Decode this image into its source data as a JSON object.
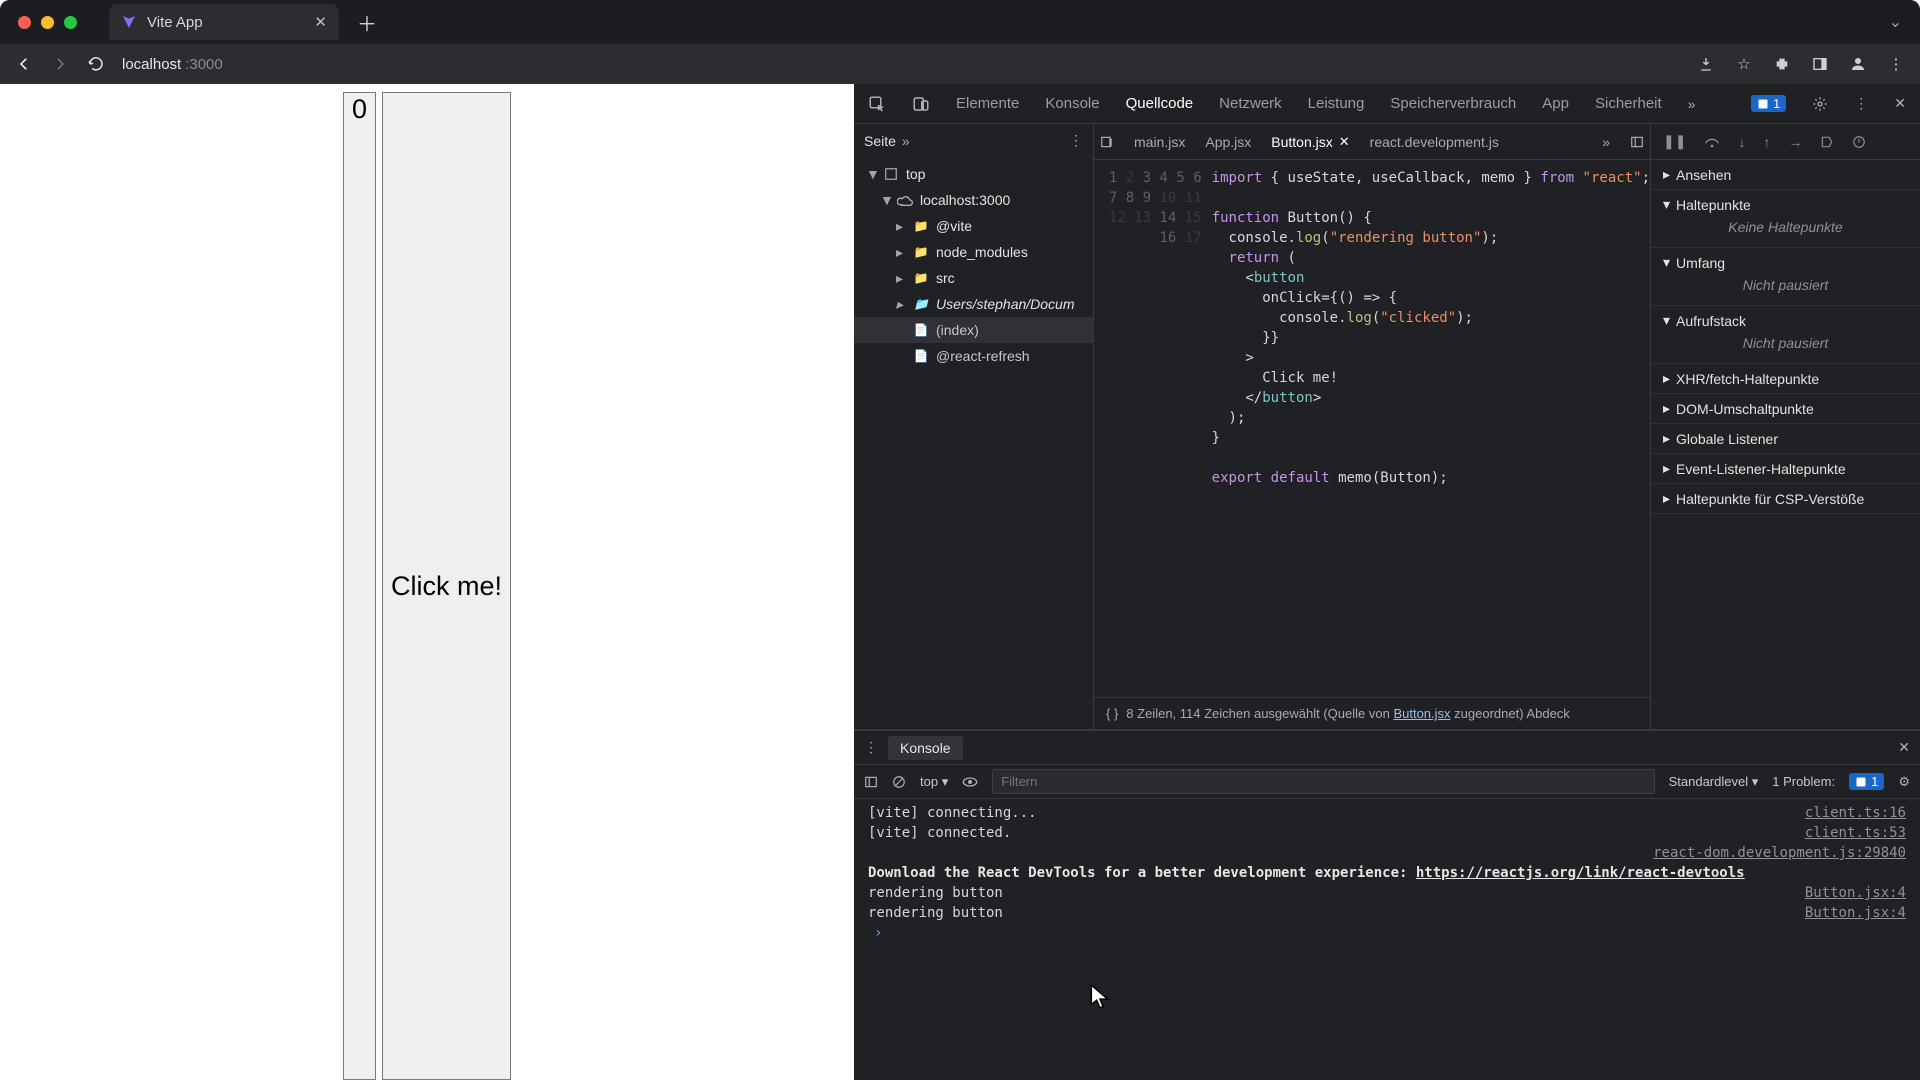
{
  "browser": {
    "tab_title": "Vite App",
    "address_host": "localhost",
    "address_port": ":3000"
  },
  "page": {
    "counter": "0",
    "button_label": "Click me!"
  },
  "devtools": {
    "tabs": [
      "Elemente",
      "Konsole",
      "Quellcode",
      "Netzwerk",
      "Leistung",
      "Speicherverbrauch",
      "App",
      "Sicherheit"
    ],
    "active_tab": "Quellcode",
    "issues_count": "1"
  },
  "nav": {
    "title": "Seite",
    "nodes": {
      "top": "top",
      "host": "localhost:3000",
      "vite": "@vite",
      "node_modules": "node_modules",
      "src": "src",
      "userpath": "Users/stephan/Docum",
      "index": "(index)",
      "refresh": "@react-refresh"
    }
  },
  "file_tabs": [
    "main.jsx",
    "App.jsx",
    "Button.jsx",
    "react.development.js"
  ],
  "active_file": "Button.jsx",
  "code": {
    "line_numbers": [
      "1",
      "2",
      "3",
      "4",
      "5",
      "6",
      "7",
      "8",
      "9",
      "10",
      "11",
      "12",
      "13",
      "14",
      "15",
      "16",
      "17"
    ],
    "l1": "import { useState, useCallback, memo } from \"react\";",
    "l3": "function Button() {",
    "l4": "  console.log(\"rendering button\");",
    "l5": "  return (",
    "l6": "    <button",
    "l7": "      onClick={() => {",
    "l8": "        console.log(\"clicked\");",
    "l9": "      }}",
    "l10": "    >",
    "l11": "      Click me!",
    "l12": "    </button>",
    "l13": "  );",
    "l14": "}",
    "l16": "export default memo(Button);"
  },
  "footer": {
    "brace": "{ }",
    "stats_pre": "8 Zeilen, 114 Zeichen ausgewählt  (Quelle von ",
    "stats_link": "Button.jsx",
    "stats_post": " zugeordnet)  Abdeck"
  },
  "rpane": {
    "watch": "Ansehen",
    "breakpoints": "Haltepunkte",
    "breakpoints_empty": "Keine Haltepunkte",
    "scope": "Umfang",
    "callstack": "Aufrufstack",
    "not_paused": "Nicht pausiert",
    "xhr": "XHR/fetch-Haltepunkte",
    "dom": "DOM-Umschaltpunkte",
    "global": "Globale Listener",
    "event": "Event-Listener-Haltepunkte",
    "csp": "Haltepunkte für CSP-Verstöße"
  },
  "console": {
    "title": "Konsole",
    "ctx": "top",
    "filter_placeholder": "Filtern",
    "level": "Standardlevel",
    "problems_label": "1 Problem:",
    "problems_count": "1",
    "logs": {
      "l1": "[vite] connecting...",
      "l1s": "client.ts:16",
      "l2": "[vite] connected.",
      "l2s": "client.ts:53",
      "l3s": "react-dom.development.js:29840",
      "l4a": "Download the React DevTools for a better development experience: ",
      "l4b": "https://reactjs.org/link/react-devtools",
      "l5": "rendering button",
      "l5s": "Button.jsx:4",
      "l6": "rendering button",
      "l6s": "Button.jsx:4",
      "prompt": "›"
    }
  }
}
